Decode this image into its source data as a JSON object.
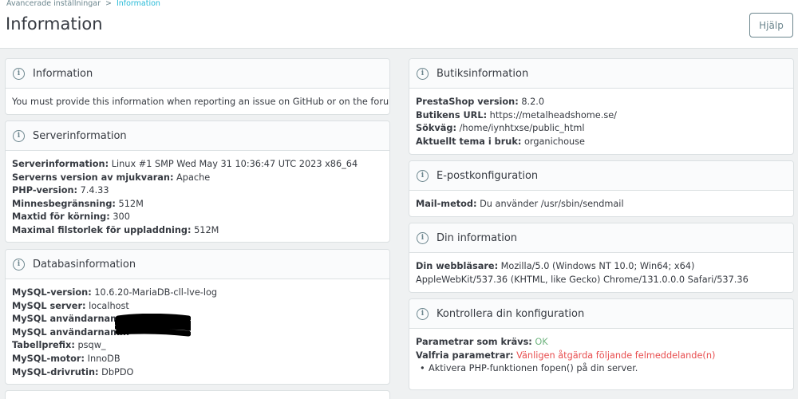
{
  "breadcrumb": {
    "parent": "Avancerade inställningar",
    "separator": ">",
    "current": "Information"
  },
  "page_title": "Information",
  "help_button": "Hjälp",
  "left": {
    "information": {
      "title": "Information",
      "text": "You must provide this information when reporting an issue on GitHub or on the forum."
    },
    "server": {
      "title": "Serverinformation",
      "rows": [
        {
          "label": "Serverinformation:",
          "value": " Linux #1 SMP Wed May 31 10:36:47 UTC 2023 x86_64"
        },
        {
          "label": "Serverns version av mjukvaran:",
          "value": " Apache"
        },
        {
          "label": "PHP-version:",
          "value": " 7.4.33"
        },
        {
          "label": "Minnesbegränsning:",
          "value": " 512M"
        },
        {
          "label": "Maxtid för körning:",
          "value": " 300"
        },
        {
          "label": "Maximal filstorlek för uppladdning:",
          "value": " 512M"
        }
      ]
    },
    "database": {
      "title": "Databasinformation",
      "rows": [
        {
          "label": "MySQL-version:",
          "value": " 10.6.20-MariaDB-cll-lve-log"
        },
        {
          "label": "MySQL server:",
          "value": " localhost"
        },
        {
          "label": "MySQL användarnamn:",
          "value": ""
        },
        {
          "label": "MySQL användarnamn:",
          "value": ""
        },
        {
          "label": "Tabellprefix:",
          "value": " psqw_"
        },
        {
          "label": "MySQL-motor:",
          "value": " InnoDB"
        },
        {
          "label": "MySQL-drivrutin:",
          "value": " DbPDO"
        }
      ]
    }
  },
  "right": {
    "shop": {
      "title": "Butiksinformation",
      "rows": [
        {
          "label": "PrestaShop version:",
          "value": " 8.2.0"
        },
        {
          "label": "Butikens URL:",
          "value": " https://metalheadshome.se/"
        },
        {
          "label": "Sökväg:",
          "value": " /home/iynhtxse/public_html"
        },
        {
          "label": "Aktuellt tema i bruk:",
          "value": " organichouse"
        }
      ]
    },
    "mail": {
      "title": "E-postkonfiguration",
      "rows": [
        {
          "label": "Mail-metod:",
          "value": " Du använder /usr/sbin/sendmail"
        }
      ]
    },
    "yourinfo": {
      "title": "Din information",
      "rows": [
        {
          "label": "Din webbläsare:",
          "value": " Mozilla/5.0 (Windows NT 10.0; Win64; x64) AppleWebKit/537.36 (KHTML, like Gecko) Chrome/131.0.0.0 Safari/537.36"
        }
      ]
    },
    "check": {
      "title": "Kontrollera din konfiguration",
      "required_label": "Parametrar som krävs:",
      "required_value": " OK",
      "optional_label": "Valfria parametrar:",
      "optional_value": " Vänligen åtgärda följande felmeddelande(n)",
      "items": [
        "Aktivera PHP-funktionen fopen() på din server."
      ]
    }
  },
  "colors": {
    "accent": "#25b9d7",
    "ok": "#70b580",
    "error": "#e84e4f"
  },
  "icons": {
    "card_header": "info-circle-icon"
  }
}
